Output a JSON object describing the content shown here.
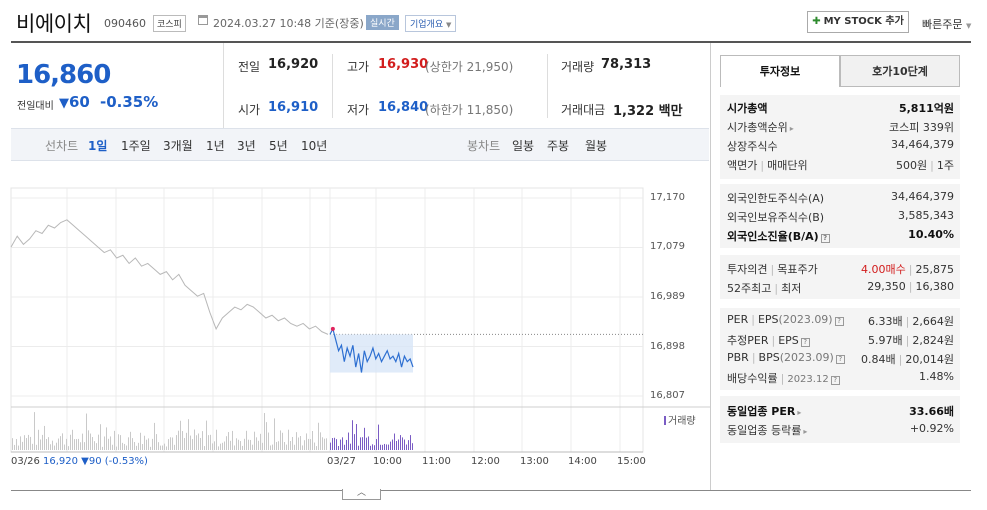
{
  "header": {
    "name": "비에이치",
    "code": "090460",
    "market": "코스피",
    "datetime": "2024.03.27 10:48 기준(장중)",
    "live_badge": "실시간",
    "overview_label": "기업개요",
    "mystock_label": "MY STOCK 추가",
    "quick_order_label": "빠른주문"
  },
  "price": {
    "current": "16,860",
    "change_label": "전일대비",
    "change_value": "60",
    "change_pct": "-0.35%"
  },
  "quote": {
    "prev_label": "전일",
    "prev": "16,920",
    "high_label": "고가",
    "high": "16,930",
    "upper_limit": "(상한가 21,950)",
    "volume_label": "거래량",
    "volume": "78,313",
    "open_label": "시가",
    "open": "16,910",
    "low_label": "저가",
    "low": "16,840",
    "lower_limit": "(하한가 11,850)",
    "amount_label": "거래대금",
    "amount": "1,322",
    "amount_unit": "백만"
  },
  "period_bar": {
    "line_label": "선차트",
    "line_options": [
      "1일",
      "1주일",
      "3개월",
      "1년",
      "3년",
      "5년",
      "10년"
    ],
    "selected": "1일",
    "candle_label": "봉차트",
    "candle_options": [
      "일봉",
      "주봉",
      "월봉"
    ]
  },
  "chart_data": {
    "type": "line",
    "y_ticks": [
      "17,170",
      "17,079",
      "16,989",
      "16,898",
      "16,807"
    ],
    "ylim": [
      16807,
      17170
    ],
    "x_ticks": [
      "03/26",
      "03/27",
      "10:00",
      "11:00",
      "12:00",
      "13:00",
      "14:00",
      "15:00"
    ],
    "prev_day_summary": "03/26  16,920 ▼90 (-0.53%)",
    "volume_legend": "거래량",
    "prev_close": 16920,
    "series": [
      {
        "name": "03/26",
        "values": [
          17080,
          17100,
          17085,
          17095,
          17110,
          17105,
          17120,
          17115,
          17125,
          17130,
          17120,
          17110,
          17100,
          17090,
          17080,
          17070,
          17075,
          17060,
          17065,
          17050,
          17060,
          17045,
          17050,
          17040,
          17030,
          17035,
          17020,
          17030,
          17010,
          17000,
          16990,
          16995,
          16960,
          16930,
          16950,
          16960,
          16970,
          16965,
          16975,
          16970,
          16960,
          16950,
          16955,
          16945,
          16950,
          16940,
          16935,
          16940,
          16930,
          16935,
          16925,
          16920
        ]
      },
      {
        "name": "03/27",
        "values": [
          16920,
          16930,
          16910,
          16890,
          16900,
          16870,
          16895,
          16880,
          16900,
          16860,
          16885,
          16850,
          16890,
          16870,
          16880,
          16895,
          16875,
          16885,
          16870,
          16880,
          16890,
          16875,
          16880,
          16870,
          16885,
          16860,
          16880,
          16870,
          16875,
          16860
        ]
      }
    ]
  },
  "tabs": [
    "투자정보",
    "호가10단계"
  ],
  "info": {
    "market_cap_label": "시가총액",
    "market_cap": "5,811억원",
    "market_cap_rank_label": "시가총액순위",
    "market_cap_rank": "코스피 339위",
    "shares_label": "상장주식수",
    "shares": "34,464,379",
    "par_label": "액면가",
    "trade_unit_label": "매매단위",
    "par": "500원",
    "trade_unit": "1주",
    "foreign_limit_label": "외국인한도주식수(A)",
    "foreign_limit": "34,464,379",
    "foreign_hold_label": "외국인보유주식수(B)",
    "foreign_hold": "3,585,343",
    "foreign_ratio_label": "외국인소진율(B/A)",
    "foreign_ratio": "10.40%",
    "opinion_label": "투자의견",
    "target_label": "목표주가",
    "opinion": "4.00매수",
    "target": "25,875",
    "w52_high_label": "52주최고",
    "w52_low_label": "최저",
    "w52_high": "29,350",
    "w52_low": "16,380",
    "per_label": "PER",
    "eps_label": "EPS",
    "eps_year": "(2023.09)",
    "per": "6.33배",
    "eps": "2,664원",
    "est_per_label": "추정PER",
    "est_eps_label": "EPS",
    "est_per": "5.97배",
    "est_eps": "2,824원",
    "pbr_label": "PBR",
    "bps_label": "BPS",
    "bps_year": "(2023.09)",
    "pbr": "0.84배",
    "bps": "20,014원",
    "div_label": "배당수익률",
    "div_year": "2023.12",
    "div": "1.48%",
    "sector_per_label": "동일업종 PER",
    "sector_per": "33.66배",
    "sector_rate_label": "동일업종 등락률",
    "sector_rate": "+0.92%"
  }
}
